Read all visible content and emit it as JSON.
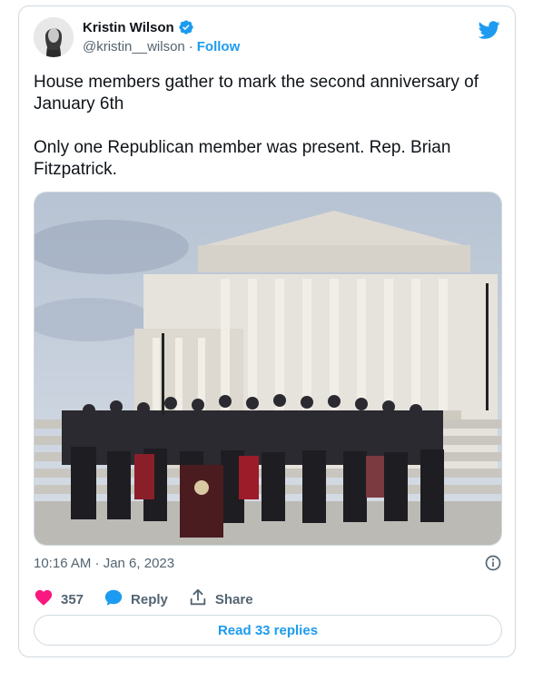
{
  "author": {
    "name": "Kristin Wilson",
    "handle": "@kristin__wilson",
    "separator": "·",
    "follow_label": "Follow"
  },
  "tweet": {
    "text": "House members gather to mark the second anniversary of January 6th\n\nOnly one Republican member was present. Rep. Brian Fitzpatrick.",
    "timestamp": "10:16 AM · Jan 6, 2023"
  },
  "actions": {
    "like_count": "357",
    "reply_label": "Reply",
    "share_label": "Share"
  },
  "footer": {
    "read_replies_label": "Read 33 replies"
  },
  "colors": {
    "accent": "#1d9bf0",
    "like": "#f91880",
    "muted": "#536471",
    "border": "#cfd9de"
  },
  "icons": [
    "verified-badge-icon",
    "twitter-bird-icon",
    "info-icon",
    "heart-icon",
    "reply-bubble-icon",
    "share-icon"
  ]
}
